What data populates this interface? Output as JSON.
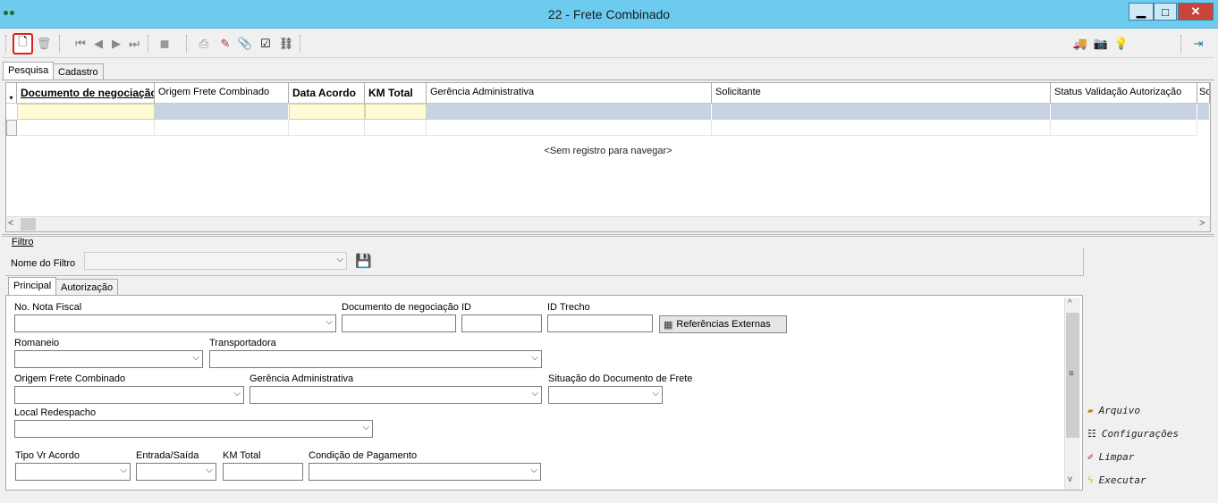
{
  "window": {
    "title": "22 - Frete Combinado",
    "min_glyph": "▁",
    "max_glyph": "□",
    "close_glyph": "✕"
  },
  "toolbar": {
    "new": "🗋",
    "delete": "🗑",
    "first": "⏮",
    "prev": "◀",
    "next": "▶",
    "last": "⏭",
    "stop": "■",
    "print": "⎙",
    "eraser": "✎",
    "attach": "📎",
    "report": "☑",
    "link": "⛓",
    "truck": "🚚",
    "camera": "📷",
    "bulb": "💡",
    "exit": "⇥"
  },
  "tabs": {
    "pesquisa": "Pesquisa",
    "cadastro": "Cadastro"
  },
  "grid": {
    "columns": [
      "Documento de negociação",
      "Origem Frete Combinado",
      "Data Acordo",
      "KM Total",
      "Gerência Administrativa",
      "Solicitante",
      "Status Validação Autorização",
      "So"
    ],
    "empty_message": "<Sem registro para navegar>"
  },
  "filter": {
    "group_label": "Filtro",
    "name_label": "Nome do Filtro",
    "save_icon": "💾"
  },
  "subtabs": {
    "principal": "Principal",
    "autorizacao": "Autorização"
  },
  "form": {
    "nota_fiscal": "No. Nota Fiscal",
    "documento": "Documento de negociação",
    "id": "ID",
    "id_trecho": "ID Trecho",
    "referencias": "Referências Externas",
    "romaneio": "Romaneio",
    "transportadora": "Transportadora",
    "origem": "Origem Frete Combinado",
    "gerencia": "Gerência Administrativa",
    "situacao": "Situação do Documento de Frete",
    "local": "Local Redespacho",
    "tipo_vr": "Tipo Vr Acordo",
    "entrada_saida": "Entrada/Saída",
    "km_total": "KM Total",
    "condicao": "Condição de Pagamento"
  },
  "actions": {
    "arquivo": "Arquivo",
    "configuracoes": "Configurações",
    "limpar": "Limpar",
    "executar": "Executar"
  }
}
